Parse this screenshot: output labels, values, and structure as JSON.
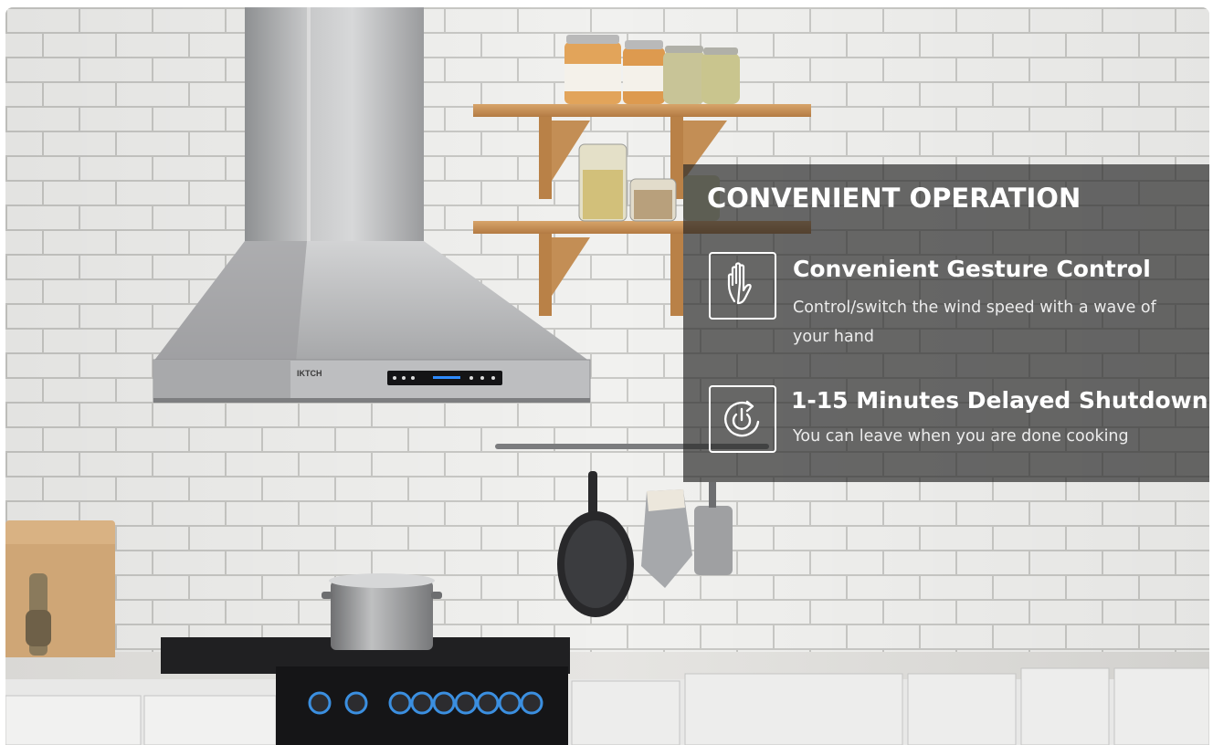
{
  "overlay": {
    "title": "CONVENIENT OPERATION",
    "features": [
      {
        "icon": "hand-gesture-icon",
        "title": "Convenient Gesture Control",
        "description": "Control/switch the wind speed with a wave of your hand"
      },
      {
        "icon": "power-timer-icon",
        "title": "1-15 Minutes Delayed Shutdown",
        "description": "You can leave when you are done cooking"
      }
    ]
  },
  "range_hood": {
    "brand_label": "IKTCH"
  },
  "colors": {
    "overlay_background": "#262626",
    "overlay_text": "#ffffff",
    "stainless": "#b9babb",
    "wall_tile": "#f2f2f0",
    "grout": "#c9c9c7",
    "shelf_wood": "#c8945a",
    "stove_black": "#1b1b1d",
    "knob_glow": "#3b8fe0"
  }
}
